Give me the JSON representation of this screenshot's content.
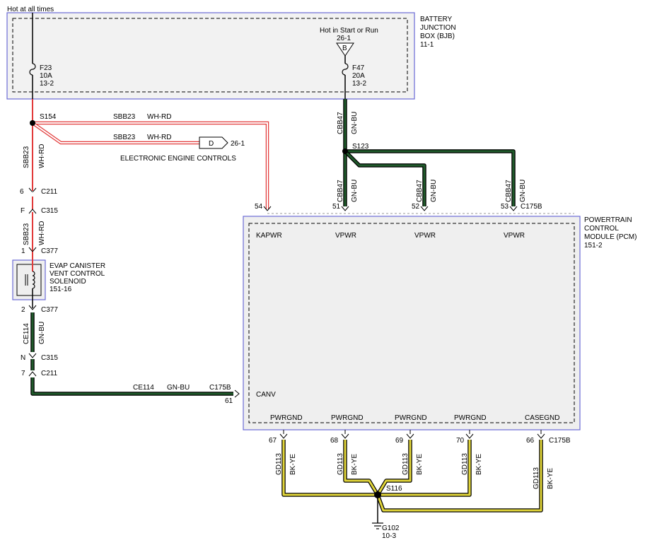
{
  "colors": {
    "green_blue_wire": "#1f5a2a",
    "blue_stripe": "#2f7bbf",
    "black_yellow_wire": "#e2d63a",
    "white_red_wire": "#e23a3a",
    "module_border": "#6b6bd6",
    "module_fill": "#efefef"
  },
  "top": {
    "hot_at_all_times": "Hot at all times"
  },
  "bjb": {
    "title_line1": "BATTERY",
    "title_line2": "JUNCTION",
    "title_line3": "BOX (BJB)",
    "ref": "11-1",
    "hot_start_run": "Hot in Start or Run",
    "hot_ref": "26-1",
    "b_symbol": "B",
    "f23_name": "F23",
    "f23_amp": "10A",
    "f23_ref": "13-2",
    "f47_name": "F47",
    "f47_amp": "20A",
    "f47_ref": "13-2"
  },
  "splices": {
    "s154": "S154",
    "s123": "S123",
    "s116": "S116"
  },
  "wires": {
    "sbb23": "SBB23",
    "whrd": "WH-RD",
    "cbb47": "CBB47",
    "gnbu": "GN-BU",
    "ce114": "CE114",
    "gd113": "GD113",
    "bkye": "BK-YE"
  },
  "eec": {
    "symbol": "D",
    "ref": "26-1",
    "label": "ELECTRONIC ENGINE CONTROLS"
  },
  "connectors": {
    "c211": "C211",
    "c315": "C315",
    "c377": "C377",
    "c175b": "C175B",
    "pin_6": "6",
    "pin_f": "F",
    "pin_1": "1",
    "pin_2": "2",
    "pin_n": "N",
    "pin_7": "7"
  },
  "solenoid": {
    "line1": "EVAP CANISTER",
    "line2": "VENT CONTROL",
    "line3": "SOLENOID",
    "ref": "151-16"
  },
  "pcm": {
    "title_line1": "POWERTRAIN",
    "title_line2": "CONTROL",
    "title_line3": "MODULE (PCM)",
    "ref": "151-2",
    "kapwr": "KAPWR",
    "vpwr": "VPWR",
    "canv": "CANV",
    "pwrgnd": "PWRGND",
    "casegnd": "CASEGND",
    "pin_54": "54",
    "pin_51": "51",
    "pin_52": "52",
    "pin_53": "53",
    "pin_61": "61",
    "pin_67": "67",
    "pin_68": "68",
    "pin_69": "69",
    "pin_70": "70",
    "pin_66": "66"
  },
  "ground": {
    "name": "G102",
    "ref": "10-3"
  }
}
